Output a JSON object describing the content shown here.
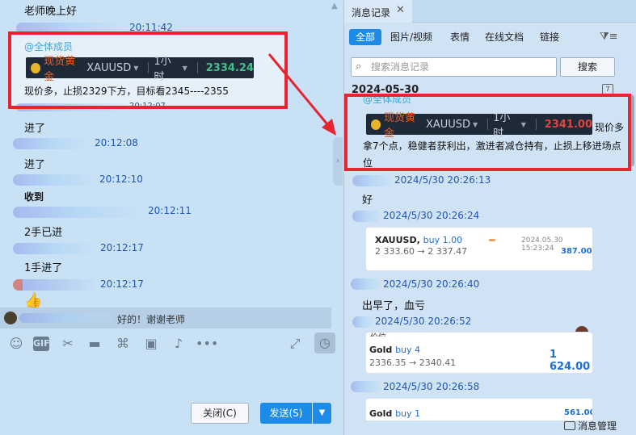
{
  "chat": {
    "greeting": "老师晚上好",
    "greeting_time": "20:11:42",
    "card": {
      "mention": "@全体成员",
      "ticker_gold": "现货黄金",
      "ticker_symbol": "XAUUSD",
      "ticker_interval": "1小时",
      "ticker_price": "2334.24",
      "text": "现价多，止损2329下方，目标看2345----2355"
    },
    "partial_time": "20:12:07",
    "messages": [
      {
        "text": "进了",
        "time": "20:12:08"
      },
      {
        "text": "进了",
        "time": "20:12:10"
      },
      {
        "text": "收到",
        "time": "20:12:11"
      },
      {
        "text": "2手已进",
        "time": "20:12:17"
      },
      {
        "text": "1手进了",
        "time": "20:12:17"
      }
    ],
    "thumbs_emoji": "👍",
    "quote_text": "好的！谢谢老师"
  },
  "toolbar": {
    "icons": [
      "emoji-icon",
      "gif-icon",
      "scissors-icon",
      "folder-icon",
      "shortcut-icon",
      "image-icon",
      "bell-icon",
      "more-icon",
      "expand-icon",
      "clock-icon"
    ],
    "gif_label": "GIF"
  },
  "actions": {
    "close_label": "关闭(C)",
    "send_label": "发送(S)"
  },
  "history": {
    "tab_title": "消息记录",
    "filters": [
      "全部",
      "图片/视频",
      "表情",
      "在线文档",
      "链接"
    ],
    "search_placeholder": "搜索消息记录",
    "search_button": "搜索",
    "date": "2024-05-30",
    "top_card": {
      "mention": "@全体成员",
      "ticker_gold": "现货黄金",
      "ticker_symbol": "XAUUSD",
      "ticker_interval": "1小时",
      "ticker_price": "2341.00",
      "suffix": "现价多",
      "text_line2": "拿7个点，稳健者获利出，激进者减仓持有，止损上移进场点",
      "text_line3": "位"
    },
    "entries": [
      {
        "time": "2024/5/30 20:26:13",
        "text": "好"
      },
      {
        "time": "2024/5/30 20:26:24"
      },
      {
        "time": "2024/5/30 20:26:40",
        "text": "出早了，血亏"
      },
      {
        "time": "2024/5/30 20:26:52"
      },
      {
        "time": "2024/5/30 20:26:58"
      }
    ],
    "trade1": {
      "symbol": "XAUUSD,",
      "direction": "buy 1.00",
      "datetime": "2024.05.30 15:23:24",
      "range": "2 333.60 → 2 337.47",
      "profit": "387.00"
    },
    "trade2": {
      "symbol": "Gold",
      "direction": "buy 4",
      "range": "2336.35 → 2340.41",
      "profit": "1 624.00",
      "top_partial": "价位"
    },
    "trade3": {
      "symbol": "Gold",
      "direction": "buy 1",
      "profit": "561.00"
    },
    "manage_label": "消息管理"
  },
  "colors": {
    "highlight": "#e52630",
    "accent": "#1d8ce8",
    "timestamp": "#1f55b5",
    "price_up": "#3fc18a",
    "price_down": "#e0443f"
  }
}
